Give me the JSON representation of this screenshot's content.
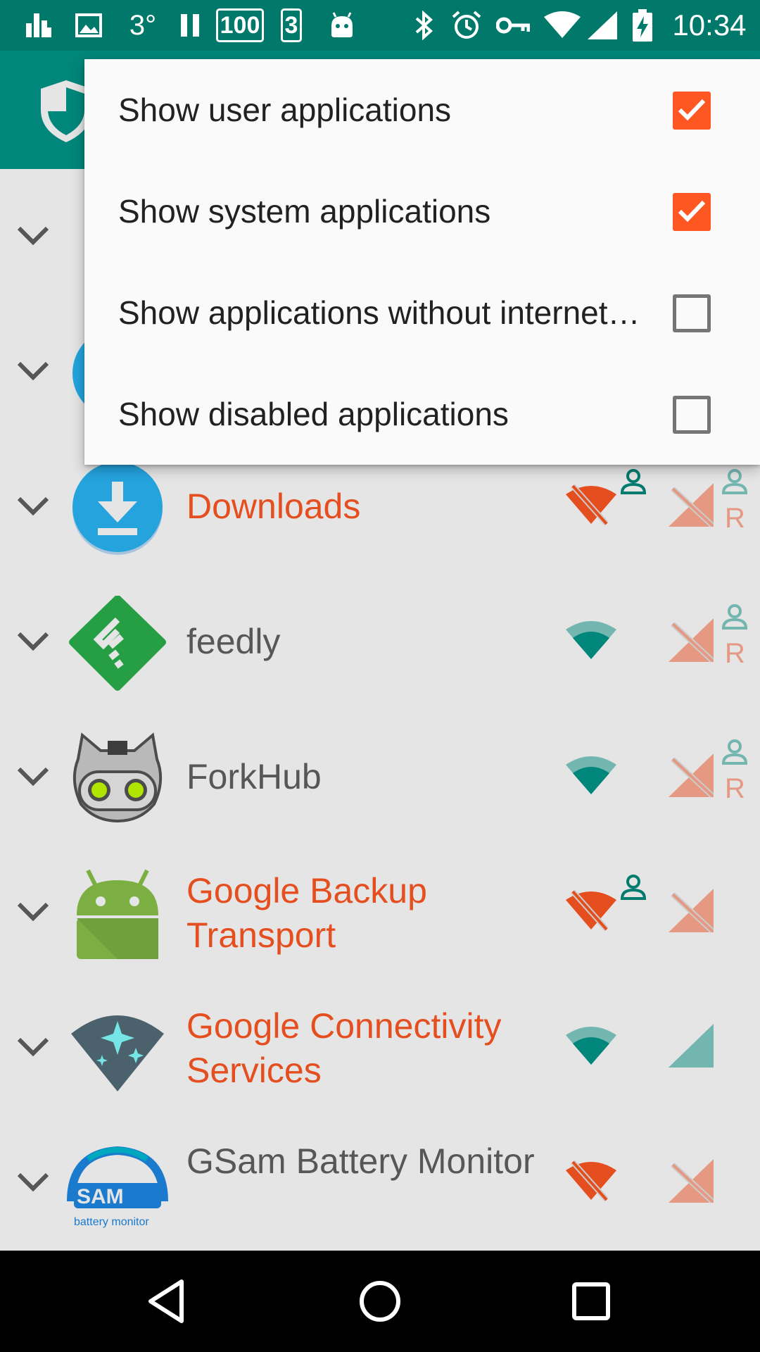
{
  "status_bar": {
    "temperature": "3°",
    "badge_battery": "100",
    "badge_count": "3",
    "time": "10:34"
  },
  "menu": {
    "items": [
      {
        "label": "Show user applications",
        "checked": true
      },
      {
        "label": "Show system applications",
        "checked": true
      },
      {
        "label": "Show applications without internet permission",
        "checked": false
      },
      {
        "label": "Show disabled applications",
        "checked": false
      }
    ]
  },
  "apps": [
    {
      "name": "",
      "system": false
    },
    {
      "name": "",
      "system": false
    },
    {
      "name": "Downloads",
      "system": true,
      "wifi_blocked": true,
      "wifi_user": true,
      "mobile_blocked": true,
      "mobile_user": true,
      "roaming": "R"
    },
    {
      "name": "feedly",
      "system": false,
      "wifi_blocked": false,
      "wifi_user": false,
      "mobile_blocked": true,
      "mobile_user": true,
      "roaming": "R"
    },
    {
      "name": "ForkHub",
      "system": false,
      "wifi_blocked": false,
      "wifi_user": false,
      "mobile_blocked": true,
      "mobile_user": true,
      "roaming": "R"
    },
    {
      "name": "Google Backup Transport",
      "system": true,
      "wifi_blocked": true,
      "wifi_user": true,
      "mobile_blocked": true,
      "mobile_user": false,
      "roaming": ""
    },
    {
      "name": "Google Connectivity Services",
      "system": true,
      "wifi_blocked": false,
      "wifi_user": false,
      "mobile_blocked": false,
      "mobile_user": false,
      "roaming": ""
    },
    {
      "name": "GSam Battery Monitor",
      "system": false,
      "wifi_blocked": true,
      "wifi_user": false,
      "mobile_blocked": true,
      "mobile_user": false,
      "roaming": ""
    }
  ],
  "icon_texts": {
    "gsam_logo": "SAM",
    "gsam_caption": "battery monitor"
  },
  "colors": {
    "primary": "#009688",
    "primary_dark": "#00796b",
    "accent": "#ff5722",
    "blocked_light": "#ffab91",
    "allowed": "#009688"
  }
}
